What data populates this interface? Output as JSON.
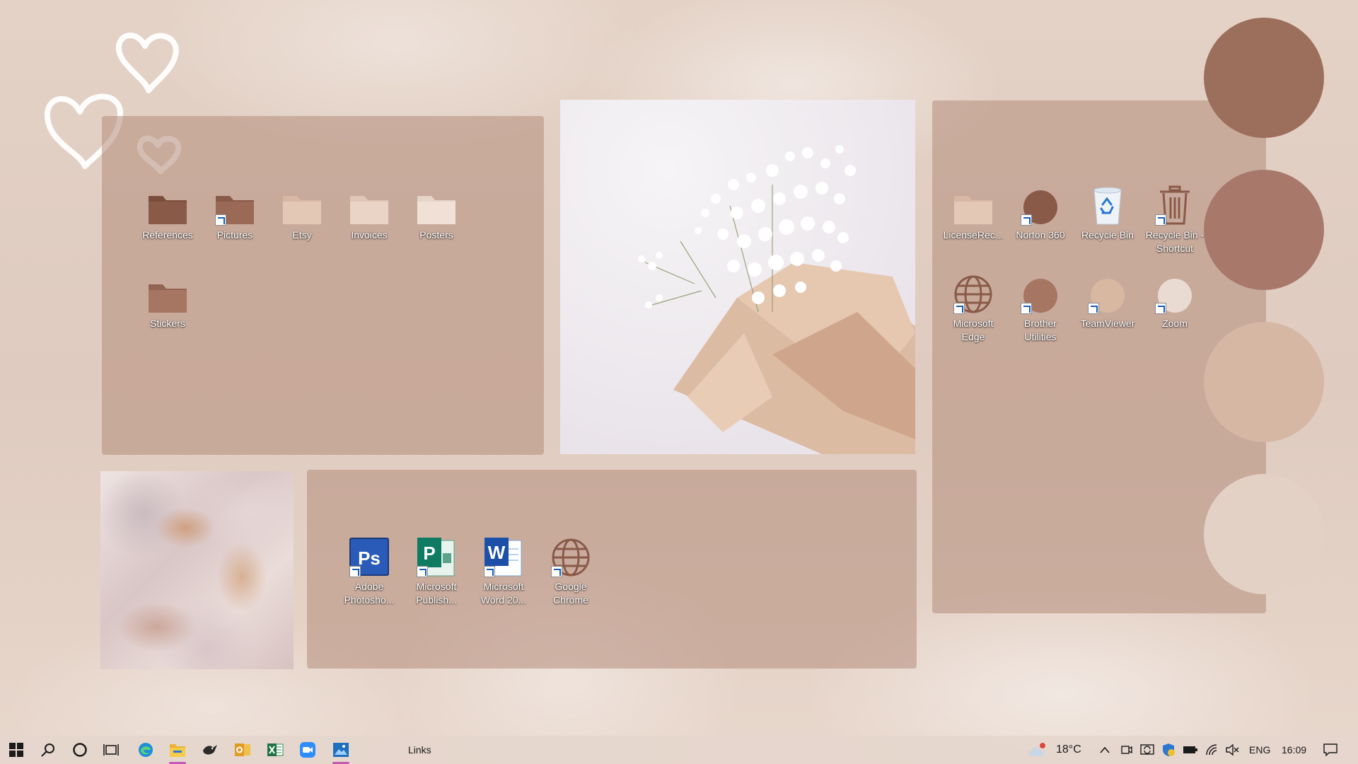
{
  "desktop": {
    "folders_panel": {
      "icons": [
        {
          "label": "References",
          "icon": "folder-dark-icon",
          "color": "#8a5a48",
          "shortcut": false
        },
        {
          "label": "Pictures",
          "icon": "folder-dark-icon",
          "color": "#9a6a56",
          "shortcut": true
        },
        {
          "label": "Etsy",
          "icon": "folder-light-icon",
          "color": "#e4c8b6",
          "shortcut": false
        },
        {
          "label": "Invoices",
          "icon": "folder-light-icon",
          "color": "#ead4c6",
          "shortcut": false
        },
        {
          "label": "Posters",
          "icon": "folder-light-icon",
          "color": "#f0e0d6",
          "shortcut": false
        },
        {
          "label": "Stickers",
          "icon": "folder-mid-icon",
          "color": "#a77662",
          "shortcut": false
        }
      ]
    },
    "apps_panel": {
      "icons": [
        {
          "label": "Adobe Photosho...",
          "icon": "photoshop-icon",
          "shortcut": true
        },
        {
          "label": "Microsoft Publish...",
          "icon": "publisher-icon",
          "shortcut": true
        },
        {
          "label": "Microsoft Word 20...",
          "icon": "word-icon",
          "shortcut": true
        },
        {
          "label": "Google Chrome",
          "icon": "globe-icon",
          "shortcut": true
        }
      ]
    },
    "right_panel": {
      "icons": [
        {
          "label": "LicenseRec...",
          "icon": "folder-light-icon",
          "shortcut": false
        },
        {
          "label": "Norton 360",
          "icon": "circle-dark-icon",
          "color": "#8a5a48",
          "shortcut": true
        },
        {
          "label": "Recycle Bin",
          "icon": "recycle-bin-icon",
          "shortcut": false
        },
        {
          "label": "Recycle Bin - Shortcut",
          "icon": "trash-icon",
          "shortcut": true
        },
        {
          "label": "Microsoft Edge",
          "icon": "globe-icon",
          "shortcut": true
        },
        {
          "label": "Brother Utilities",
          "icon": "circle-mid-icon",
          "color": "#a77662",
          "shortcut": true
        },
        {
          "label": "TeamViewer",
          "icon": "circle-light-icon",
          "color": "#d9b8a2",
          "shortcut": true
        },
        {
          "label": "Zoom",
          "icon": "circle-pale-icon",
          "color": "#eadbd2",
          "shortcut": true
        }
      ]
    },
    "palette_circles": [
      "#9c6e5c",
      "#a8786a",
      "#d5b7a4",
      "#e3d1c6"
    ]
  },
  "taskbar": {
    "start_icon": "windows-start-icon",
    "search_icon": "search-icon",
    "cortana_icon": "cortana-icon",
    "taskview_icon": "task-view-icon",
    "pinned": [
      {
        "name": "edge-taskbar-icon",
        "running": false
      },
      {
        "name": "file-explorer-taskbar-icon",
        "running": true
      },
      {
        "name": "bird-app-taskbar-icon",
        "running": false
      },
      {
        "name": "outlook-taskbar-icon",
        "running": false
      },
      {
        "name": "excel-taskbar-icon",
        "running": false
      },
      {
        "name": "zoom-taskbar-icon",
        "running": false
      },
      {
        "name": "photos-taskbar-icon",
        "running": true
      }
    ],
    "links_label": "Links",
    "weather": "18°C",
    "language": "ENG",
    "time": "16:09"
  }
}
